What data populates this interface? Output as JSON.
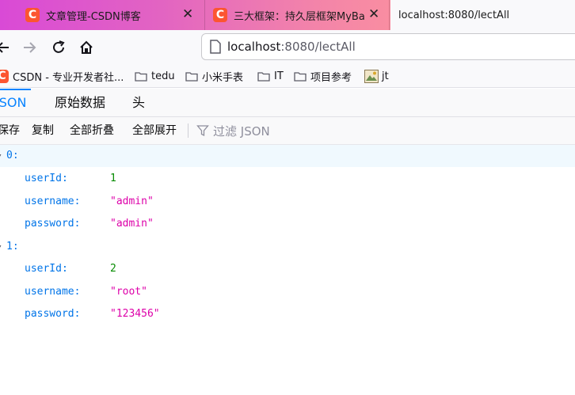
{
  "browser": {
    "tabs": [
      {
        "title": "文章管理-CSDN博客",
        "favicon": "csdn-icon"
      },
      {
        "title": "三大框架：持久层框架MyBa",
        "favicon": "csdn-icon"
      },
      {
        "title": "localhost:8080/lectAll",
        "favicon": ""
      }
    ],
    "close_glyph": "✕",
    "url": {
      "host": "localhost",
      "path": ":8080/lectAll"
    },
    "bookmarks": [
      {
        "label": "CSDN - 专业开发者社...",
        "icon": "csdn-icon"
      },
      {
        "label": "tedu",
        "icon": "folder-icon"
      },
      {
        "label": "小米手表",
        "icon": "folder-icon"
      },
      {
        "label": "IT",
        "icon": "folder-icon"
      },
      {
        "label": "项目参考",
        "icon": "folder-icon"
      },
      {
        "label": "jt",
        "icon": "image-icon"
      }
    ],
    "accent": "#0a84ff"
  },
  "viewer": {
    "tabs": [
      "JSON",
      "原始数据",
      "头"
    ],
    "selected_tab": "JSON",
    "toolbar": {
      "save": "保存",
      "copy": "复制",
      "collapse_all": "全部折叠",
      "expand_all": "全部展开",
      "filter_placeholder": "过滤 JSON"
    }
  },
  "json": {
    "items": [
      {
        "index": "0:",
        "fields": [
          {
            "key": "userId:",
            "value": "1"
          },
          {
            "key": "username:",
            "value": "\"admin\""
          },
          {
            "key": "password:",
            "value": "\"admin\""
          }
        ]
      },
      {
        "index": "1:",
        "fields": [
          {
            "key": "userId:",
            "value": "2"
          },
          {
            "key": "username:",
            "value": "\"root\""
          },
          {
            "key": "password:",
            "value": "\"123456\""
          }
        ]
      }
    ]
  }
}
